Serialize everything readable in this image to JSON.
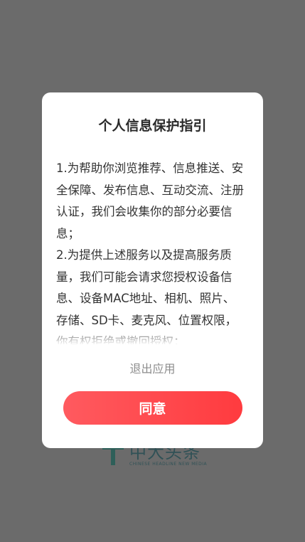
{
  "background": {
    "logo_cn": "中大头条",
    "logo_en": "CHINESE HEADLINE NEW MEDIA"
  },
  "dialog": {
    "title": "个人信息保护指引",
    "paragraphs": [
      "1.为帮助你浏览推荐、信息推送、安全保障、发布信息、互动交流、注册认证，我们会收集你的部分必要信息；",
      "2.为提供上述服务以及提高服务质量，我们可能会请求您授权设备信息、设备MAC地址、相机、照片、存储、SD卡、麦克风、位置权限，你有权拒绝或撤回授权；"
    ],
    "exit_label": "退出应用",
    "agree_label": "同意"
  },
  "colors": {
    "overlay": "#6b6b6b",
    "accent": "#ff4a4f"
  }
}
